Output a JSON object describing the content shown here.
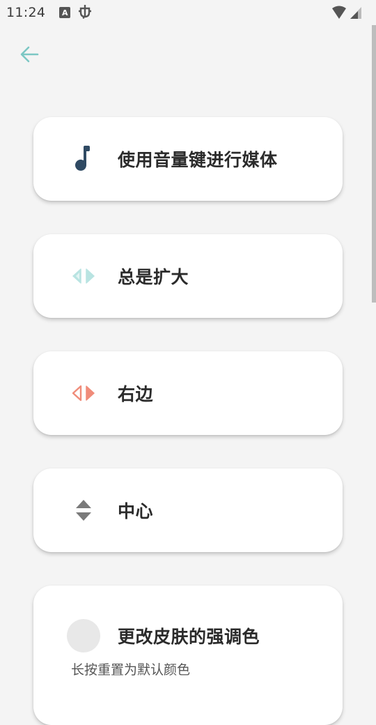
{
  "status_bar": {
    "time": "11:24",
    "notif_icon_a": "A",
    "notif_icon_bug": "bug-icon"
  },
  "colors": {
    "accent_teal": "#7cc7c4",
    "music_icon": "#2f4a63",
    "right_edge_icon": "#f08c7a",
    "center_icon": "#7a7a7a"
  },
  "settings": {
    "items": [
      {
        "label": "使用音量键进行媒体",
        "icon": "music-note-icon"
      },
      {
        "label": "总是扩大",
        "icon": "expand-horizontal-icon"
      },
      {
        "label": "右边",
        "icon": "right-edge-icon"
      },
      {
        "label": "中心",
        "icon": "center-vertical-icon"
      },
      {
        "label": "更改皮肤的强调色",
        "sub": "长按重置为默认颜色",
        "icon": "color-swatch"
      }
    ]
  }
}
